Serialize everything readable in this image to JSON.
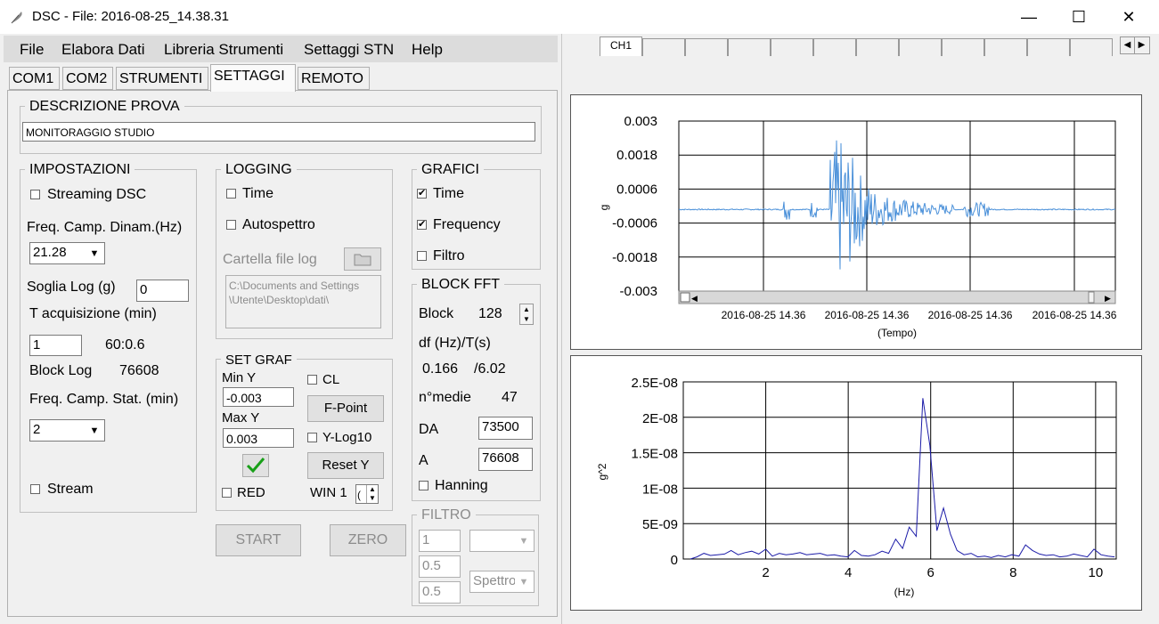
{
  "window": {
    "title": "DSC - File: 2016-08-25_14.38.31",
    "minimize_glyph": "—",
    "maximize_glyph": "☐",
    "close_glyph": "✕"
  },
  "menu": [
    "File",
    "Elabora Dati",
    "Libreria Strumenti",
    "Settaggi STN",
    "Help"
  ],
  "tabs": [
    "COM1",
    "COM2",
    "STRUMENTI",
    "SETTAGGI",
    "REMOTO"
  ],
  "selected_tab": "SETTAGGI",
  "descrizione": {
    "title": "DESCRIZIONE PROVA",
    "value": "MONITORAGGIO STUDIO"
  },
  "impostazioni": {
    "title": "IMPOSTAZIONI",
    "streaming_label": "Streaming DSC",
    "streaming_checked": false,
    "freq_dinam_label": "Freq. Camp. Dinam.(Hz)",
    "freq_dinam_value": "21.28",
    "soglia_label": "Soglia Log (g)",
    "soglia_value": "0",
    "t_acq_label": "T acquisizione (min)",
    "t_acq_value": "1",
    "t_acq_readout": "60:0.6",
    "block_log_label": "Block Log",
    "block_log_value": "76608",
    "freq_stat_label": "Freq. Camp. Stat. (min)",
    "freq_stat_value": "2",
    "stream_label": "Stream",
    "stream_checked": false
  },
  "logging": {
    "title": "LOGGING",
    "time_label": "Time",
    "time_checked": false,
    "auto_label": "Autospettro",
    "auto_checked": false,
    "cartella_label": "Cartella file log",
    "path_line1": "C:\\Documents and Settings",
    "path_line2": "\\Utente\\Desktop\\dati\\"
  },
  "setgraf": {
    "title": "SET GRAF",
    "miny_label": "Min Y",
    "miny_value": "-0.003",
    "maxy_label": "Max Y",
    "maxy_value": "0.003",
    "cl_label": "CL",
    "fpoint_label": "F-Point",
    "ylog_label": "Y-Log10",
    "resety_label": "Reset Y",
    "red_label": "RED",
    "win_label": "WIN 1",
    "win_value": "("
  },
  "grafici": {
    "title": "GRAFICI",
    "time_label": "Time",
    "time_checked": true,
    "freq_label": "Frequency",
    "freq_checked": true,
    "filtro_label": "Filtro",
    "filtro_checked": false
  },
  "blockfft": {
    "title": "BLOCK FFT",
    "block_label": "Block",
    "block_value": "128",
    "df_label": "df (Hz)/T(s)",
    "df_value": "0.166",
    "t_value": "/6.02",
    "nmedie_label": "n°medie",
    "nmedie_value": "47",
    "da_label": "DA",
    "da_value": "73500",
    "a_label": "A",
    "a_value": "76608",
    "hanning_label": "Hanning",
    "hanning_checked": false
  },
  "filtro": {
    "title": "FILTRO",
    "v1": "1",
    "v2": "0.5",
    "v3": "0.5",
    "type_value": "Spettro"
  },
  "buttons": {
    "start": "START",
    "zero": "ZERO"
  },
  "channel_tabs": [
    "CH1",
    "",
    "",
    "",
    "",
    "",
    "",
    "",
    "",
    "",
    "",
    ""
  ],
  "chart_data": [
    {
      "type": "line",
      "title": "",
      "xlabel": "(Tempo)",
      "ylabel": "g",
      "ylim": [
        -0.003,
        0.003
      ],
      "yticks": [
        "0.003",
        "0.0018",
        "0.0006",
        "-0.0006",
        "-0.0018",
        "-0.003"
      ],
      "xticks": [
        "2016-08-25 14.36",
        "2016-08-25 14.36",
        "2016-08-25 14.36",
        "2016-08-25 14.36"
      ],
      "grid": true,
      "color": "#4a90d9",
      "note_values": "acceleration trace, baseline ~ -0.00012 with burst up to ~ ±0.002"
    },
    {
      "type": "line",
      "title": "",
      "xlabel": "(Hz)",
      "ylabel": "g^2",
      "xlim": [
        0,
        10.5
      ],
      "ylim": [
        0,
        2.5e-08
      ],
      "yticks": [
        "2.5E-08",
        "2E-08",
        "1.5E-08",
        "1E-08",
        "5E-09",
        "0"
      ],
      "xticks": [
        "2",
        "4",
        "6",
        "8",
        "10"
      ],
      "grid": true,
      "color": "#1c1ca8",
      "x": [
        0.17,
        0.33,
        0.5,
        0.66,
        0.83,
        1.0,
        1.16,
        1.33,
        1.5,
        1.66,
        1.83,
        2.0,
        2.16,
        2.33,
        2.49,
        2.66,
        2.83,
        2.99,
        3.16,
        3.32,
        3.49,
        3.66,
        3.82,
        3.99,
        4.15,
        4.32,
        4.49,
        4.65,
        4.82,
        4.98,
        5.15,
        5.32,
        5.48,
        5.65,
        5.81,
        5.98,
        6.15,
        6.31,
        6.48,
        6.64,
        6.81,
        6.98,
        7.14,
        7.31,
        7.47,
        7.64,
        7.81,
        7.97,
        8.14,
        8.3,
        8.47,
        8.64,
        8.8,
        8.97,
        9.13,
        9.3,
        9.47,
        9.63,
        9.8,
        9.96,
        10.13,
        10.3,
        10.46
      ],
      "values": [
        0,
        3e-10,
        8e-10,
        5e-10,
        6e-10,
        7e-10,
        1.2e-09,
        6e-10,
        9e-10,
        1.1e-09,
        7e-10,
        1.4e-09,
        4e-10,
        8e-10,
        6e-10,
        7e-10,
        9e-10,
        6e-10,
        7e-10,
        8e-10,
        5e-10,
        6e-10,
        4e-10,
        3e-10,
        1.2e-09,
        5e-10,
        4e-10,
        6e-10,
        1.1e-09,
        8e-10,
        2.8e-09,
        1.5e-09,
        4.5e-09,
        3.2e-09,
        2.27e-08,
        1.6e-08,
        4e-09,
        7.2e-09,
        3.5e-09,
        1.2e-09,
        6e-10,
        8e-10,
        3e-10,
        4e-10,
        2e-10,
        5e-10,
        3e-10,
        6e-10,
        4e-10,
        2e-09,
        1.2e-09,
        7e-10,
        5e-10,
        6e-10,
        3e-10,
        4e-10,
        7e-10,
        5e-10,
        3e-10,
        1.4e-09,
        6e-10,
        4e-10,
        3e-10
      ]
    }
  ]
}
